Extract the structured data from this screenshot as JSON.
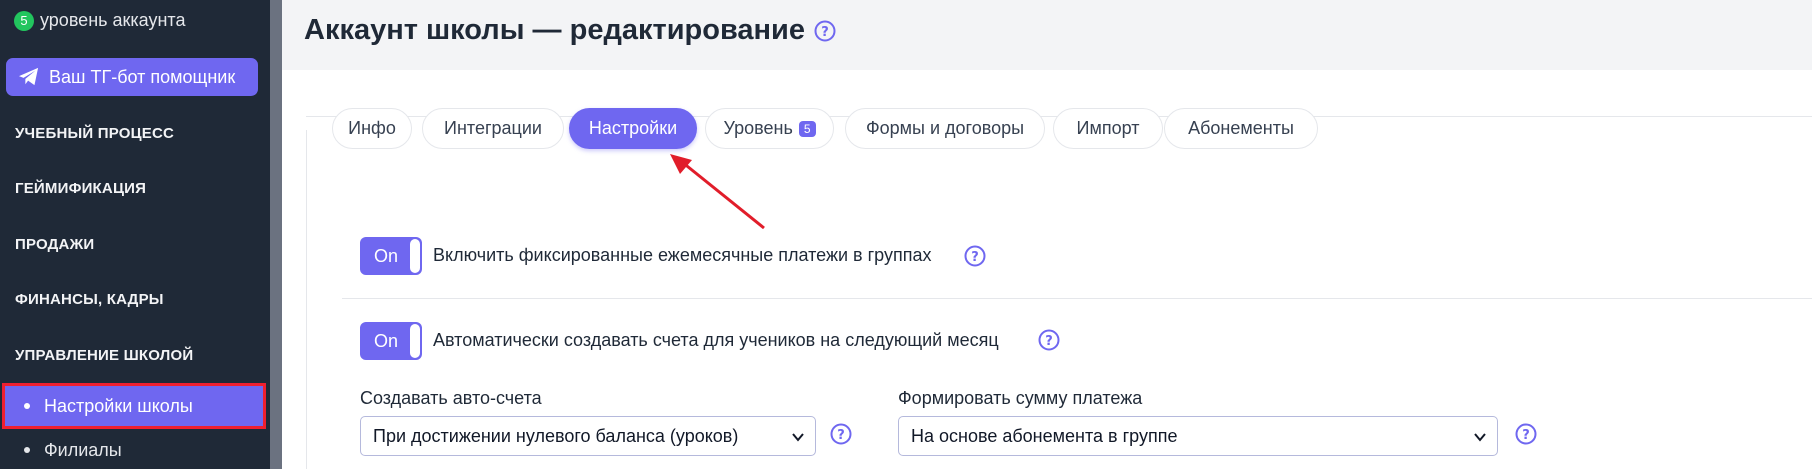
{
  "sidebar": {
    "level_badge": "5",
    "level_text": "уровень аккаунта",
    "tg_button": "Ваш ТГ-бот помощник",
    "sections": [
      "УЧЕБНЫЙ ПРОЦЕСС",
      "ГЕЙМИФИКАЦИЯ",
      "ПРОДАЖИ",
      "ФИНАНСЫ, КАДРЫ",
      "УПРАВЛЕНИЕ ШКОЛОЙ"
    ],
    "active_item": "Настройки школы",
    "next_item": "Филиалы"
  },
  "page": {
    "title": "Аккаунт школы — редактирование"
  },
  "tabs": [
    {
      "label": "Инфо"
    },
    {
      "label": "Интеграции"
    },
    {
      "label": "Настройки"
    },
    {
      "label": "Уровень",
      "badge": "5"
    },
    {
      "label": "Формы и договоры"
    },
    {
      "label": "Импорт"
    },
    {
      "label": "Абонементы"
    }
  ],
  "settings": {
    "toggle1": {
      "state": "On",
      "label": "Включить фиксированные ежемесячные платежи в группах"
    },
    "toggle2": {
      "state": "On",
      "label": "Автоматически создавать счета для учеников на следующий месяц"
    },
    "auto_invoice": {
      "label": "Создавать авто-счета",
      "value": "При достижении нулевого баланса (уроков)"
    },
    "payment_sum": {
      "label": "Формировать сумму платежа",
      "value": "На основе абонемента в группе"
    }
  },
  "colors": {
    "accent": "#6f67f0",
    "sidebar_bg": "#1f2937",
    "highlight_border": "#ef1f2f",
    "annotation_arrow": "#e11d2a"
  }
}
